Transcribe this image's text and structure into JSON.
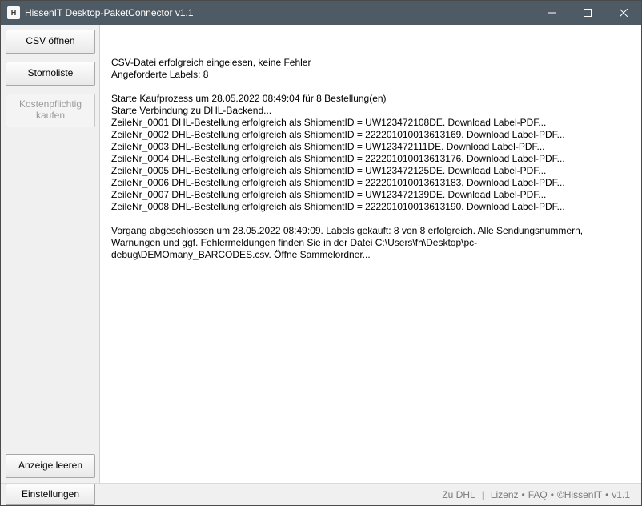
{
  "window": {
    "title": "HissenIT Desktop-PaketConnector v1.1",
    "icon_label": "H"
  },
  "sidebar": {
    "csv_open": "CSV öffnen",
    "stornoliste": "Stornoliste",
    "buy": "Kostenpflichtig\nkaufen",
    "clear_display": "Anzeige leeren",
    "settings": "Einstellungen"
  },
  "log": {
    "intro": [
      "CSV-Datei erfolgreich eingelesen, keine Fehler",
      "Angeforderte Labels: 8"
    ],
    "process": [
      "Starte Kaufprozess um 28.05.2022 08:49:04 für 8 Bestellung(en)",
      "Starte Verbindung zu DHL-Backend...",
      "ZeileNr_0001 DHL-Bestellung erfolgreich als ShipmentID = UW123472108DE. Download Label-PDF...",
      "ZeileNr_0002 DHL-Bestellung erfolgreich als ShipmentID = 222201010013613169. Download Label-PDF...",
      "ZeileNr_0003 DHL-Bestellung erfolgreich als ShipmentID = UW123472111DE. Download Label-PDF...",
      "ZeileNr_0004 DHL-Bestellung erfolgreich als ShipmentID = 222201010013613176. Download Label-PDF...",
      "ZeileNr_0005 DHL-Bestellung erfolgreich als ShipmentID = UW123472125DE. Download Label-PDF...",
      "ZeileNr_0006 DHL-Bestellung erfolgreich als ShipmentID = 222201010013613183. Download Label-PDF...",
      "ZeileNr_0007 DHL-Bestellung erfolgreich als ShipmentID = UW123472139DE. Download Label-PDF...",
      "ZeileNr_0008 DHL-Bestellung erfolgreich als ShipmentID = 222201010013613190. Download Label-PDF..."
    ],
    "summary": "Vorgang abgeschlossen um 28.05.2022 08:49:09. Labels gekauft: 8 von 8 erfolgreich. Alle Sendungsnummern, Warnungen und ggf. Fehlermeldungen finden Sie in der Datei C:\\Users\\fh\\Desktop\\pc-debug\\DEMOmany_BARCODES.csv. Öffne Sammelordner..."
  },
  "status": {
    "to_dhl": "Zu DHL",
    "lizenz": "Lizenz",
    "faq": "FAQ",
    "copyright": "©HissenIT",
    "version": "v1.1"
  }
}
